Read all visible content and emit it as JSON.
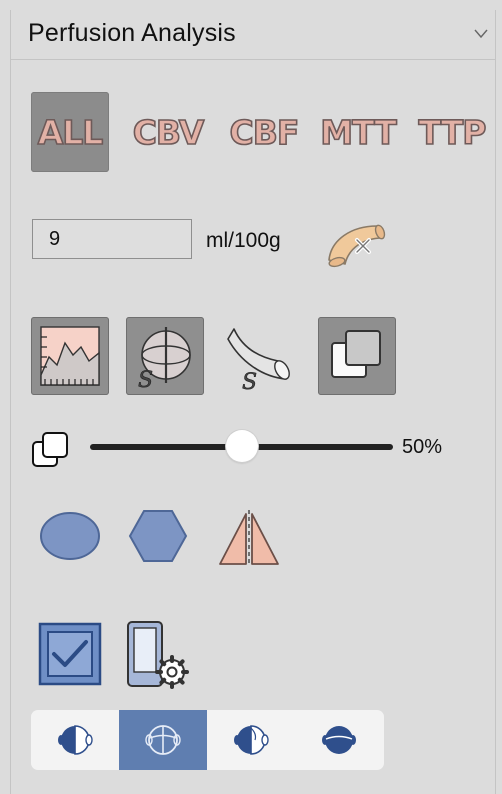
{
  "panel": {
    "title": "Perfusion Analysis",
    "collapse_icon": "chevron-down-icon"
  },
  "map_modes": [
    {
      "label": "ALL",
      "selected": true
    },
    {
      "label": "CBV",
      "selected": false
    },
    {
      "label": "CBF",
      "selected": false
    },
    {
      "label": "MTT",
      "selected": false
    },
    {
      "label": "TTP",
      "selected": false
    }
  ],
  "threshold": {
    "value": "9",
    "unit": "ml/100g",
    "action_icon": "vessel-remove-icon"
  },
  "tools": [
    {
      "icon": "curve-chart-icon",
      "pressed": true
    },
    {
      "icon": "symmetry-sphere-icon",
      "pressed": true
    },
    {
      "icon": "vessel-s-icon",
      "pressed": false
    },
    {
      "icon": "overlay-icon",
      "pressed": true
    }
  ],
  "opacity": {
    "icon": "overlay-opacity-icon",
    "value": 50,
    "label": "50%"
  },
  "roi_tools": [
    {
      "icon": "ellipse-roi-icon"
    },
    {
      "icon": "hexagon-roi-icon"
    },
    {
      "icon": "mirror-roi-icon"
    }
  ],
  "options": [
    {
      "icon": "checkbox-checked-icon",
      "checked": true
    },
    {
      "icon": "device-settings-icon"
    }
  ],
  "view_modes": [
    {
      "icon": "left-hemisphere-icon",
      "selected": false
    },
    {
      "icon": "full-brain-icon",
      "selected": true
    },
    {
      "icon": "right-hemisphere-icon",
      "selected": false
    },
    {
      "icon": "top-view-icon",
      "selected": false
    }
  ],
  "colors": {
    "background": "#dcdcdc",
    "active_button": "#8c8c8c",
    "map_label_fill": "#e2b1a6",
    "map_label_stroke": "#6e5a59",
    "accent_blue": "#5f7eb0",
    "shape_fill": "#7d95c4"
  }
}
